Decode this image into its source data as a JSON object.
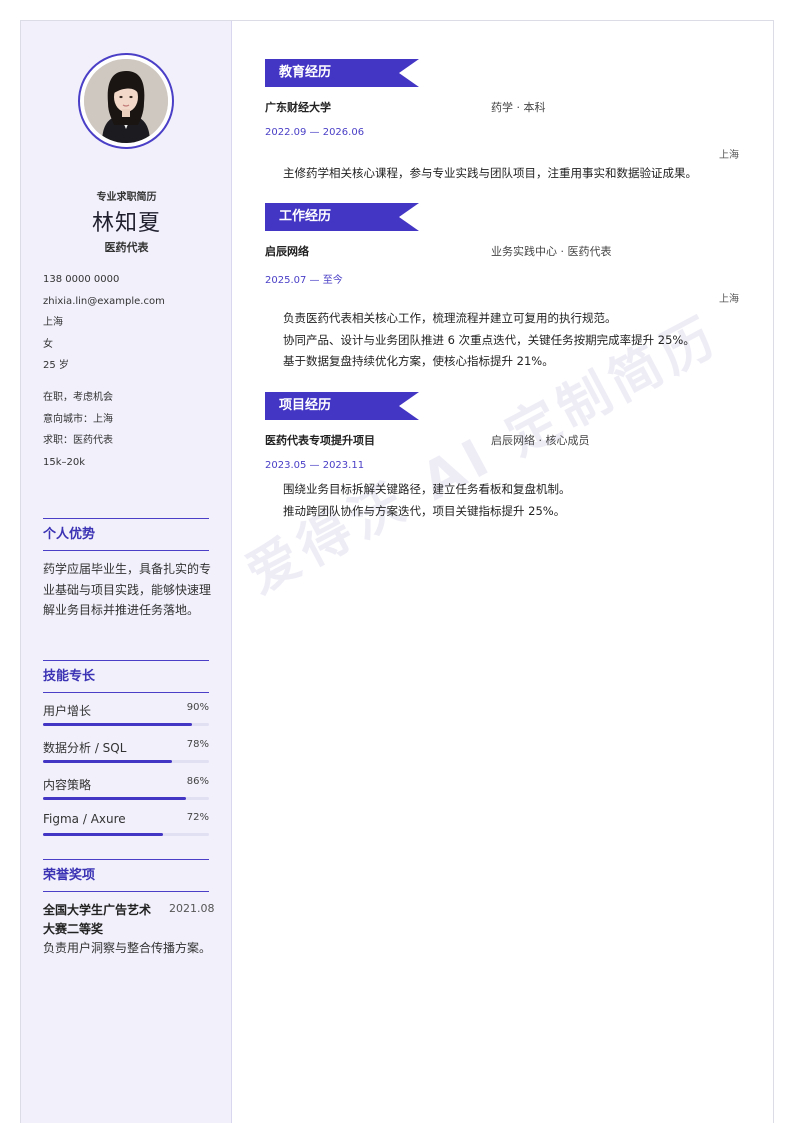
{
  "profile": {
    "tagline": "专业求职简历",
    "name": "林知夏",
    "role": "医药代表",
    "contact": [
      "138 0000 0000",
      "zhixia.lin@example.com",
      "上海",
      "女",
      "25 岁"
    ],
    "status": [
      "在职，考虑机会",
      "意向城市：上海",
      "求职：医药代表",
      "15k–20k"
    ]
  },
  "advantage": {
    "title": "个人优势",
    "text": "药学应届毕业生，具备扎实的专业基础与项目实践，能够快速理解业务目标并推进任务落地。"
  },
  "skills": {
    "title": "技能专长",
    "items": [
      {
        "label": "用户增长",
        "pct_text": "90%",
        "level": 0.9
      },
      {
        "label": "数据分析 / SQL",
        "pct_text": "78%",
        "level": 0.78
      },
      {
        "label": "内容策略",
        "pct_text": "86%",
        "level": 0.86
      },
      {
        "label": "Figma / Axure",
        "pct_text": "72%",
        "level": 0.72
      }
    ]
  },
  "awards": {
    "title": "荣誉奖项",
    "item": {
      "title": "全国大学生广告艺术大赛二等奖",
      "date": "2021.08",
      "desc": "负责用户洞察与整合传播方案。"
    }
  },
  "education": {
    "title": "教育经历",
    "org": "广东财经大学",
    "role": "药学 · 本科",
    "date": "2022.09 — 2026.06",
    "location": "上海",
    "lines": [
      "主修药学相关核心课程，参与专业实践与团队项目，注重用事实和数据验证成果。"
    ]
  },
  "work": {
    "title": "工作经历",
    "org": "启辰网络",
    "role": "业务实践中心 · 医药代表",
    "date": "2025.07 — 至今",
    "location": "上海",
    "lines": [
      "负责医药代表相关核心工作，梳理流程并建立可复用的执行规范。",
      "协同产品、设计与业务团队推进 6 次重点迭代，关键任务按期完成率提升 25%。",
      "基于数据复盘持续优化方案，使核心指标提升 21%。"
    ]
  },
  "project": {
    "title": "项目经历",
    "org": "医药代表专项提升项目",
    "role": "启辰网络 · 核心成员",
    "date": "2023.05 — 2023.11",
    "lines": [
      "围绕业务目标拆解关键路径，建立任务看板和复盘机制。",
      "推动跨团队协作与方案迭代，项目关键指标提升 25%。"
    ]
  },
  "watermark": "爱得沃 AI 定制简历",
  "colors": {
    "accent": "#4436c4",
    "sidebar_bg": "#f1f0fb"
  }
}
